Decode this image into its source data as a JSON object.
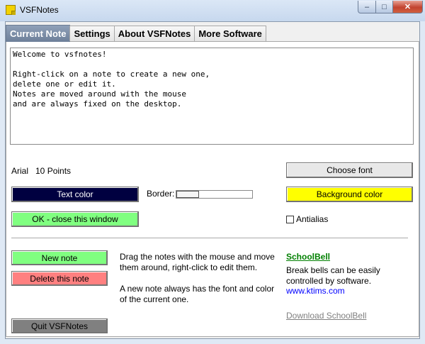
{
  "window": {
    "title": "VSFNotes",
    "minimize_glyph": "–",
    "maximize_glyph": "□",
    "close_glyph": "✕"
  },
  "tabs": [
    {
      "label": "Current Note",
      "active": true
    },
    {
      "label": "Settings",
      "active": false
    },
    {
      "label": "About VSFNotes",
      "active": false
    },
    {
      "label": "More Software",
      "active": false
    }
  ],
  "note": {
    "text": "Welcome to vsfnotes!\n\nRight-click on a note to create a new one,\ndelete one or edit it.\nNotes are moved around with the mouse\nand are always fixed on the desktop."
  },
  "font": {
    "label": "Arial   10 Points",
    "choose_button": "Choose font"
  },
  "colors": {
    "text_color_label": "Text color",
    "text_color_value": "#000040",
    "background_color_label": "Background color",
    "background_color_value": "#ffff00"
  },
  "border": {
    "label": "Border:",
    "level": 0.3
  },
  "ok_close_label": "OK - close this window",
  "antialias": {
    "label": "Antialias",
    "checked": false
  },
  "actions": {
    "new_note": "New note",
    "delete_note": "Delete this note",
    "quit": "Quit VSFNotes"
  },
  "help": {
    "line1": "Drag the notes with the mouse and move them around, right-click to edit them.",
    "line2": "A new note always has the font and color of the current one."
  },
  "schoolbell": {
    "title": "SchoolBell",
    "description": "Break bells can be easily controlled by software.",
    "url": "www.ktims.com",
    "download": "Download SchoolBell"
  }
}
